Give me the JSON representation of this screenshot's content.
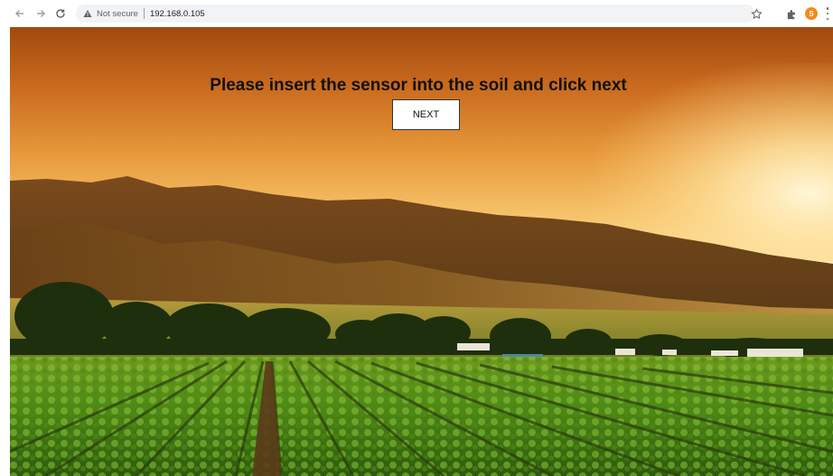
{
  "browser": {
    "security_label": "Not secure",
    "url": "192.168.0.105",
    "profile_initial": "S",
    "icons": {
      "back": "arrow-left-icon",
      "forward": "arrow-right-icon",
      "reload": "reload-icon",
      "warning": "warning-triangle-icon",
      "bookmark": "star-icon",
      "extensions": "puzzle-icon",
      "menu": "vertical-dots-icon"
    },
    "colors": {
      "profile_avatar": "#f28b1e"
    }
  },
  "page": {
    "instruction": "Please insert the sensor into the soil and click next",
    "next_label": "NEXT",
    "background": "farm-field-sunset-photo"
  }
}
